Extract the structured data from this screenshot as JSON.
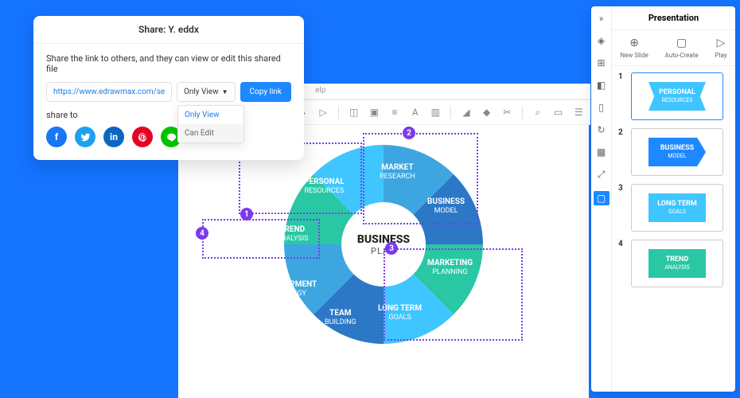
{
  "share": {
    "title": "Share: Y. eddx",
    "desc": "Share the link to others, and they can view or edit this shared file",
    "url": "https://www.edrawmax.com/server..",
    "perm_selected": "Only View",
    "perm_options": [
      "Only View",
      "Can Edit"
    ],
    "copy": "Copy link",
    "shareto": "share to"
  },
  "topbar": {
    "help": "elp"
  },
  "diagram": {
    "center": {
      "title": "BUSINESS",
      "sub": "PLAN"
    },
    "segments": [
      {
        "title": "MARKET",
        "sub": "RESEARCH"
      },
      {
        "title": "BUSINESS",
        "sub": "MODEL"
      },
      {
        "title": "MARKETING",
        "sub": "PLANNING"
      },
      {
        "title": "LONG TERM",
        "sub": "GOALS"
      },
      {
        "title": "TEAM",
        "sub": "BUILDING"
      },
      {
        "title": "DEVELOPMENT",
        "sub": "STRATEGY"
      },
      {
        "title": "TREND",
        "sub": "ANALYSIS"
      },
      {
        "title": "PERSONAL",
        "sub": "RESOURCES"
      }
    ],
    "markers": [
      "1",
      "2",
      "3",
      "4"
    ]
  },
  "panel": {
    "title": "Presentation",
    "actions": [
      {
        "label": "New Slide"
      },
      {
        "label": "Auto-Create"
      },
      {
        "label": "Play"
      }
    ],
    "slides": [
      {
        "n": "1",
        "title": "PERSONAL",
        "sub": "RESOURCES",
        "color": "#3fc5ff"
      },
      {
        "n": "2",
        "title": "BUSINESS",
        "sub": "MODEL",
        "color": "#1e88ff"
      },
      {
        "n": "3",
        "title": "LONG TERM",
        "sub": "GOALS",
        "color": "#3fc5ff"
      },
      {
        "n": "4",
        "title": "TREND",
        "sub": "ANALYSIS",
        "color": "#2ac7a5"
      }
    ]
  }
}
